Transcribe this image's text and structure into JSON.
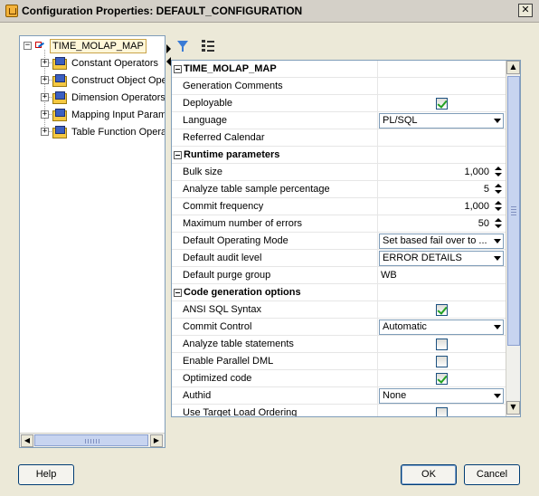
{
  "window": {
    "title": "Configuration Properties: DEFAULT_CONFIGURATION",
    "close_label": "✕"
  },
  "tree": {
    "root": {
      "label": "TIME_MOLAP_MAP",
      "expander": "−",
      "icon": "mapping-icon"
    },
    "children": [
      {
        "label": "Constant Operators",
        "expander": "+",
        "icon": "operator-folder-icon"
      },
      {
        "label": "Construct Object Ope",
        "expander": "+",
        "icon": "operator-folder-icon"
      },
      {
        "label": "Dimension Operators",
        "expander": "+",
        "icon": "operator-folder-icon"
      },
      {
        "label": "Mapping Input Parame",
        "expander": "+",
        "icon": "operator-folder-icon"
      },
      {
        "label": "Table Function Operat",
        "expander": "+",
        "icon": "operator-folder-icon"
      }
    ]
  },
  "toolbar": {
    "filter_icon": "filter-icon",
    "categorize_icon": "categorize-icon"
  },
  "properties": {
    "rows": [
      {
        "type": "category",
        "name": "TIME_MOLAP_MAP"
      },
      {
        "type": "text",
        "name": "Generation Comments",
        "value": ""
      },
      {
        "type": "checkbox",
        "name": "Deployable",
        "checked": true
      },
      {
        "type": "dropdown",
        "name": "Language",
        "value": "PL/SQL"
      },
      {
        "type": "text",
        "name": "Referred Calendar",
        "value": ""
      },
      {
        "type": "category",
        "name": "Runtime parameters"
      },
      {
        "type": "spinner",
        "name": "Bulk size",
        "value": "1,000"
      },
      {
        "type": "spinner",
        "name": "Analyze table sample percentage",
        "value": "5"
      },
      {
        "type": "spinner",
        "name": "Commit frequency",
        "value": "1,000"
      },
      {
        "type": "spinner",
        "name": "Maximum number of errors",
        "value": "50"
      },
      {
        "type": "dropdown",
        "name": "Default Operating Mode",
        "value": "Set based fail over to ..."
      },
      {
        "type": "dropdown",
        "name": "Default audit level",
        "value": "ERROR DETAILS"
      },
      {
        "type": "text",
        "name": "Default purge group",
        "value": "WB"
      },
      {
        "type": "category",
        "name": "Code generation options"
      },
      {
        "type": "checkbox",
        "name": "ANSI SQL Syntax",
        "checked": true
      },
      {
        "type": "dropdown",
        "name": "Commit Control",
        "value": "Automatic"
      },
      {
        "type": "checkbox",
        "name": "Analyze table statements",
        "checked": false
      },
      {
        "type": "checkbox",
        "name": "Enable Parallel DML",
        "checked": false
      },
      {
        "type": "checkbox",
        "name": "Optimized code",
        "checked": true
      },
      {
        "type": "dropdown",
        "name": "Authid",
        "value": "None"
      },
      {
        "type": "checkbox",
        "name": "Use Target Load Ordering",
        "checked": false
      }
    ]
  },
  "buttons": {
    "help": "Help",
    "ok": "OK",
    "cancel": "Cancel"
  }
}
